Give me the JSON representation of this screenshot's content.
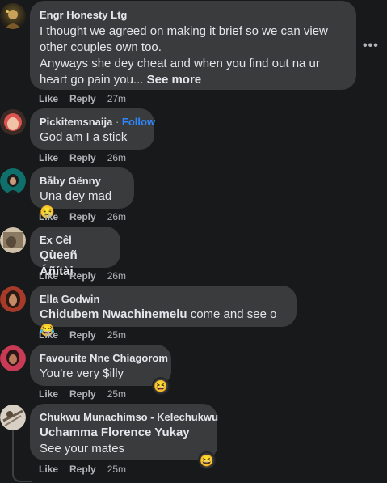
{
  "comments": [
    {
      "name": "Engr Honesty Ltg",
      "lines": [
        "I thought we agreed on making it brief so we can view",
        "other couples own too.",
        "Anyways she dey cheat and when you find out na ur",
        "heart go pain you..."
      ],
      "see_more": "See more",
      "like": "Like",
      "reply": "Reply",
      "time": "27m"
    },
    {
      "name": "Pickitemsnaija",
      "separator": "·",
      "follow": "Follow",
      "text": "God am I a stick",
      "like": "Like",
      "reply": "Reply",
      "time": "26m"
    },
    {
      "name": "Båby Gënny",
      "text": "Una dey mad",
      "emoji": "😒",
      "like": "Like",
      "reply": "Reply",
      "time": "26m"
    },
    {
      "name": "Ex Cêl",
      "tag": "Qùeeñ Áñítài",
      "like": "Like",
      "reply": "Reply",
      "time": "26m"
    },
    {
      "name": "Ella Godwin",
      "tag": "Chidubem Nwachinemelu",
      "text": " come and see o ",
      "emoji": "😂",
      "like": "Like",
      "reply": "Reply",
      "time": "25m"
    },
    {
      "name": "Favourite Nne Chiagorom",
      "text": "You're very $illy",
      "reaction": "😆",
      "like": "Like",
      "reply": "Reply",
      "time": "25m"
    },
    {
      "name": "Chukwu Munachimso - Kelechukwu",
      "tag": "Uchamma Florence Yukay",
      "text": "See your mates",
      "reaction": "😆",
      "like": "Like",
      "reply": "Reply",
      "time": "25m"
    }
  ],
  "menu_icon": "more-horizontal-icon",
  "colors": {
    "background": "#18191a",
    "bubble": "#3a3b3c",
    "link": "#2d88ff",
    "muted": "#b0b3b8"
  }
}
